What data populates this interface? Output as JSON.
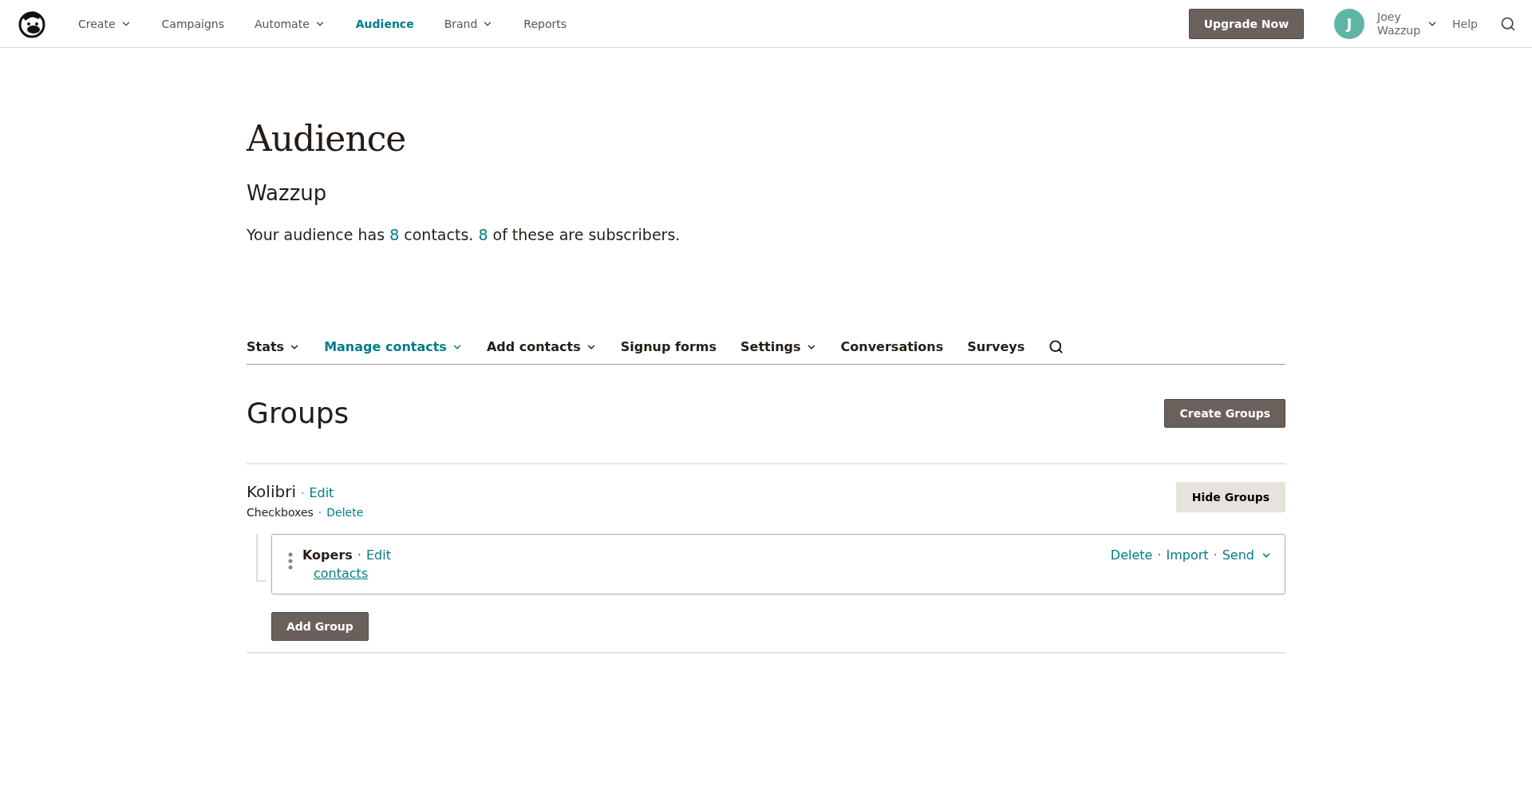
{
  "nav": {
    "items": [
      {
        "label": "Create",
        "dropdown": true,
        "selected": false
      },
      {
        "label": "Campaigns",
        "dropdown": false,
        "selected": false
      },
      {
        "label": "Automate",
        "dropdown": true,
        "selected": false
      },
      {
        "label": "Audience",
        "dropdown": false,
        "selected": true
      },
      {
        "label": "Brand",
        "dropdown": true,
        "selected": false
      },
      {
        "label": "Reports",
        "dropdown": false,
        "selected": false
      }
    ],
    "upgrade": "Upgrade Now",
    "user": {
      "initial": "J",
      "first": "Joey",
      "last": "Wazzup"
    },
    "help": "Help"
  },
  "page": {
    "title": "Audience",
    "audience_name": "Wazzup",
    "summary": [
      {
        "kind": "text",
        "text": "Your audience has "
      },
      {
        "kind": "link",
        "text": "8"
      },
      {
        "kind": "text",
        "text": " contacts. "
      },
      {
        "kind": "link",
        "text": "8"
      },
      {
        "kind": "text",
        "text": " of these are subscribers."
      }
    ]
  },
  "tabs": [
    {
      "label": "Stats",
      "dropdown": true,
      "selected": false
    },
    {
      "label": "Manage contacts",
      "dropdown": true,
      "selected": true
    },
    {
      "label": "Add contacts",
      "dropdown": true,
      "selected": false
    },
    {
      "label": "Signup forms",
      "dropdown": false,
      "selected": false
    },
    {
      "label": "Settings",
      "dropdown": true,
      "selected": false
    },
    {
      "label": "Conversations",
      "dropdown": false,
      "selected": false
    },
    {
      "label": "Surveys",
      "dropdown": false,
      "selected": false
    }
  ],
  "groups": {
    "heading": "Groups",
    "create_button": "Create Groups",
    "separator": "·",
    "category": {
      "name": "Kolibri",
      "edit": "Edit",
      "type": "Checkboxes",
      "delete": "Delete",
      "hide_button": "Hide Groups",
      "groups": [
        {
          "name": "Kopers",
          "edit": "Edit",
          "contacts": "contacts",
          "actions": [
            "Delete",
            "Import",
            "Send"
          ]
        }
      ]
    },
    "add_button": "Add Group"
  }
}
